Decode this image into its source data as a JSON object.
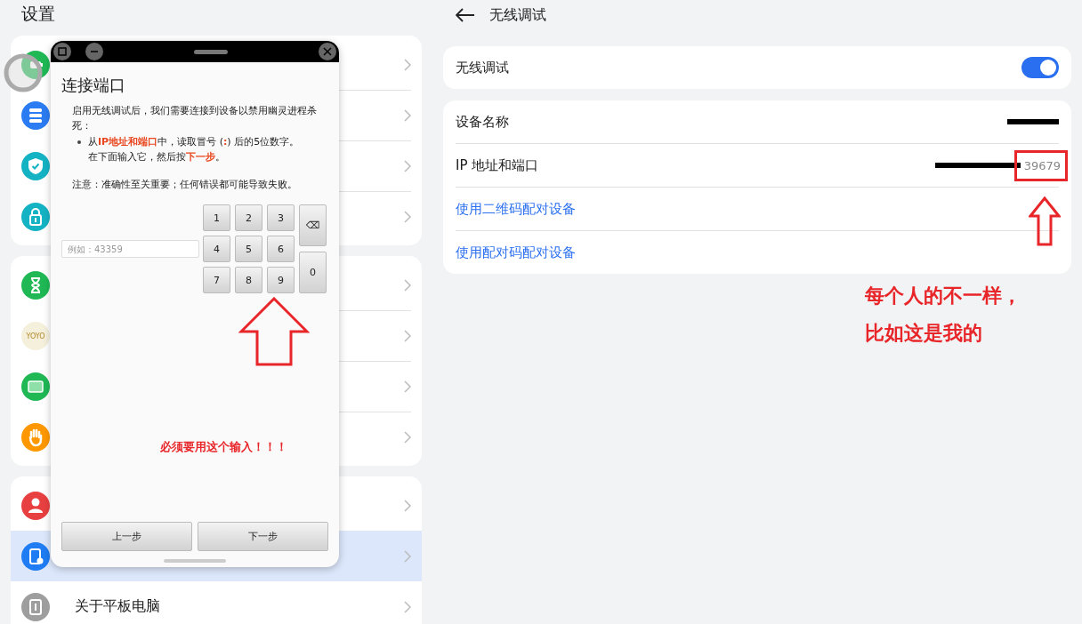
{
  "settings_title": "设置",
  "settings_groups": [
    [
      {
        "kind": "battery",
        "color": "#1fb855",
        "selected": false
      },
      {
        "kind": "storage",
        "color": "#2b7cf2",
        "selected": false
      },
      {
        "kind": "shield",
        "color": "#14b3c4",
        "selected": false
      },
      {
        "kind": "lock",
        "color": "#14b3c4",
        "selected": false
      }
    ],
    [
      {
        "kind": "hourglass",
        "color": "#1fb855",
        "selected": false
      },
      {
        "kind": "yoyo",
        "label": "YOYO",
        "color": "#f5f0dc",
        "selected": false
      },
      {
        "kind": "tablet",
        "color": "#1fb855",
        "selected": false
      },
      {
        "kind": "hand",
        "color": "#ff9800",
        "selected": false
      }
    ],
    [
      {
        "kind": "person",
        "color": "#e84040",
        "selected": false
      },
      {
        "kind": "device_gear",
        "color": "#1f7cf2",
        "selected": true
      },
      {
        "kind": "info",
        "label": "关于平板电脑",
        "color": "#9e9e9e",
        "selected": false
      }
    ]
  ],
  "page_title": "无线调试",
  "toggle": {
    "label": "无线调试",
    "on": true
  },
  "info_rows": [
    {
      "label": "设备名称",
      "kind": "redacted"
    },
    {
      "label": "IP 地址和端口",
      "kind": "redacted_port",
      "value": "39679"
    }
  ],
  "links": [
    "使用二维码配对设备",
    "使用配对码配对设备"
  ],
  "annotation_lines": [
    "每个人的不一样，",
    "比如这是我的"
  ],
  "dialog": {
    "title": "连接端口",
    "intro": "启用无线调试后，我们需要连接到设备以禁用幽灵进程杀死：",
    "bullet_lines": [
      "从**IP地址和端口**中，读取冒号 (**:**) 后的5位数字。",
      "在下面输入它，然后按**下一步**。"
    ],
    "note": "注意：准确性至关重要；任何错误都可能导致失败。",
    "input": {
      "placeholder": "例如：43359"
    },
    "keys": [
      "1",
      "2",
      "3",
      "4",
      "5",
      "6",
      "7",
      "8",
      "9"
    ],
    "backspace": "⌫",
    "zero": "0",
    "annotation": "必须要用这个输入！！！",
    "buttons": [
      "上一步",
      "下一步"
    ]
  }
}
